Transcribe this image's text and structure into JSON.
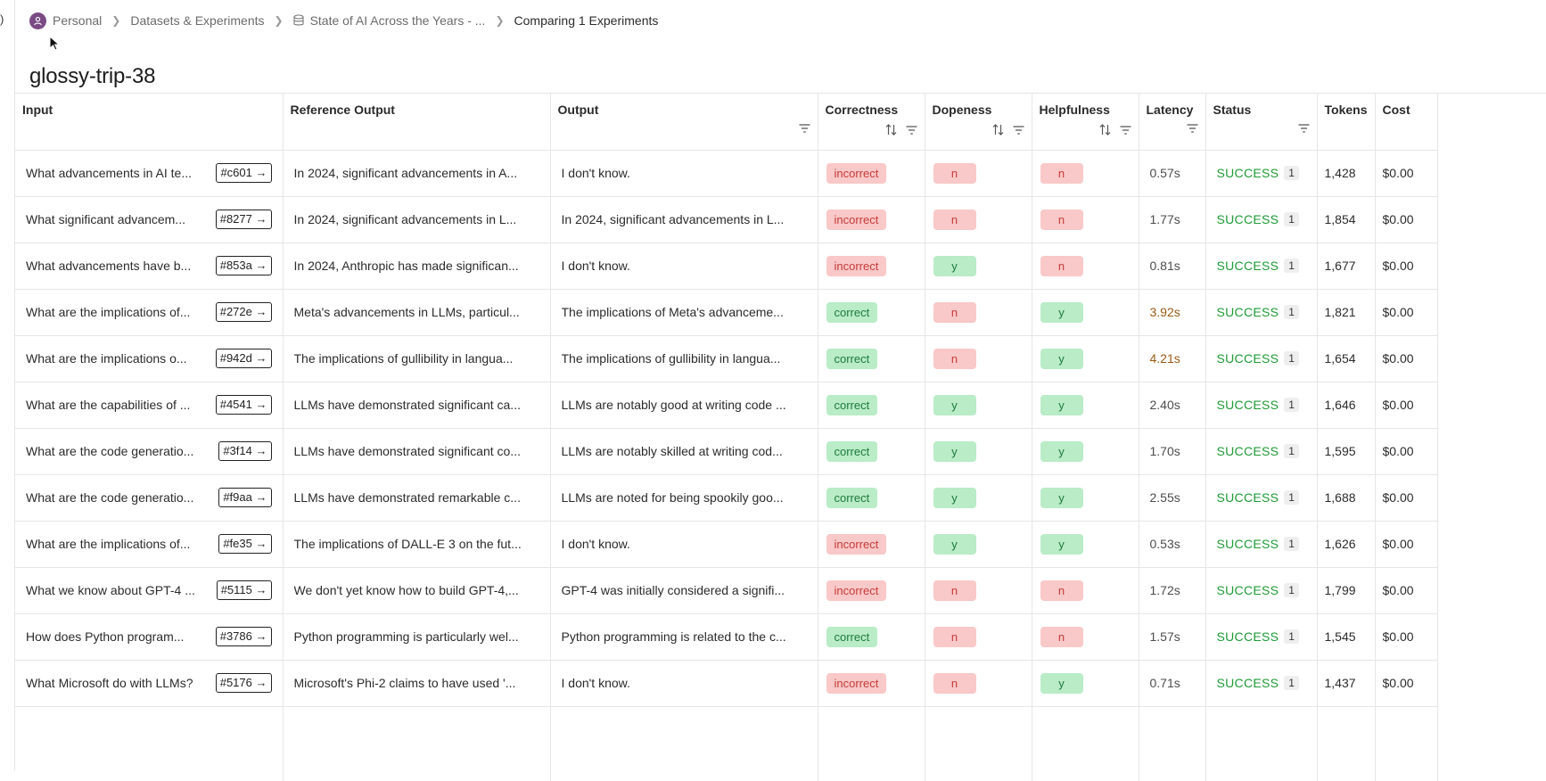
{
  "breadcrumb": {
    "personal": "Personal",
    "datasets": "Datasets & Experiments",
    "dataset": "State of AI Across the Years - ...",
    "current": "Comparing 1 Experiments"
  },
  "page_title": "glossy-trip-38",
  "columns": {
    "input": "Input",
    "reference": "Reference Output",
    "output": "Output",
    "correctness": "Correctness",
    "dopeness": "Dopeness",
    "helpfulness": "Helpfulness",
    "latency": "Latency",
    "status": "Status",
    "tokens": "Tokens",
    "cost": "Cost"
  },
  "rows": [
    {
      "input": "What advancements in AI te...",
      "id": "#c601",
      "reference": "In 2024, significant advancements in A...",
      "output": "I don't know.",
      "correctness": "incorrect",
      "dopeness": "n",
      "helpfulness": "n",
      "latency": "0.57s",
      "status": "SUCCESS",
      "count": "1",
      "tokens": "1,428",
      "cost": "$0.00"
    },
    {
      "input": "What significant advancem...",
      "id": "#8277",
      "reference": "In 2024, significant advancements in L...",
      "output": "In 2024, significant advancements in L...",
      "correctness": "incorrect",
      "dopeness": "n",
      "helpfulness": "n",
      "latency": "1.77s",
      "status": "SUCCESS",
      "count": "1",
      "tokens": "1,854",
      "cost": "$0.00"
    },
    {
      "input": "What advancements have b...",
      "id": "#853a",
      "reference": "In 2024, Anthropic has made significan...",
      "output": "I don't know.",
      "correctness": "incorrect",
      "dopeness": "y",
      "helpfulness": "n",
      "latency": "0.81s",
      "status": "SUCCESS",
      "count": "1",
      "tokens": "1,677",
      "cost": "$0.00"
    },
    {
      "input": "What are the implications of...",
      "id": "#272e",
      "reference": "Meta's advancements in LLMs, particul...",
      "output": "The implications of Meta's advanceme...",
      "correctness": "correct",
      "dopeness": "n",
      "helpfulness": "y",
      "latency": "3.92s",
      "status": "SUCCESS",
      "count": "1",
      "tokens": "1,821",
      "cost": "$0.00"
    },
    {
      "input": "What are the implications o...",
      "id": "#942d",
      "reference": "The implications of gullibility in langua...",
      "output": "The implications of gullibility in langua...",
      "correctness": "correct",
      "dopeness": "n",
      "helpfulness": "y",
      "latency": "4.21s",
      "status": "SUCCESS",
      "count": "1",
      "tokens": "1,654",
      "cost": "$0.00"
    },
    {
      "input": "What are the capabilities of ...",
      "id": "#4541",
      "reference": "LLMs have demonstrated significant ca...",
      "output": "LLMs are notably good at writing code ...",
      "correctness": "correct",
      "dopeness": "y",
      "helpfulness": "y",
      "latency": "2.40s",
      "status": "SUCCESS",
      "count": "1",
      "tokens": "1,646",
      "cost": "$0.00"
    },
    {
      "input": "What are the code generatio...",
      "id": "#3f14",
      "reference": "LLMs have demonstrated significant co...",
      "output": "LLMs are notably skilled at writing cod...",
      "correctness": "correct",
      "dopeness": "y",
      "helpfulness": "y",
      "latency": "1.70s",
      "status": "SUCCESS",
      "count": "1",
      "tokens": "1,595",
      "cost": "$0.00"
    },
    {
      "input": "What are the code generatio...",
      "id": "#f9aa",
      "reference": "LLMs have demonstrated remarkable c...",
      "output": "LLMs are noted for being spookily goo...",
      "correctness": "correct",
      "dopeness": "y",
      "helpfulness": "y",
      "latency": "2.55s",
      "status": "SUCCESS",
      "count": "1",
      "tokens": "1,688",
      "cost": "$0.00"
    },
    {
      "input": "What are the implications of...",
      "id": "#fe35",
      "reference": "The implications of DALL-E 3 on the fut...",
      "output": "I don't know.",
      "correctness": "incorrect",
      "dopeness": "y",
      "helpfulness": "y",
      "latency": "0.53s",
      "status": "SUCCESS",
      "count": "1",
      "tokens": "1,626",
      "cost": "$0.00"
    },
    {
      "input": "What we know about GPT-4 ...",
      "id": "#5115",
      "reference": "We don't yet know how to build GPT-4,...",
      "output": "GPT-4 was initially considered a signifi...",
      "correctness": "incorrect",
      "dopeness": "n",
      "helpfulness": "n",
      "latency": "1.72s",
      "status": "SUCCESS",
      "count": "1",
      "tokens": "1,799",
      "cost": "$0.00"
    },
    {
      "input": "How does Python program...",
      "id": "#3786",
      "reference": "Python programming is particularly wel...",
      "output": "Python programming is related to the c...",
      "correctness": "correct",
      "dopeness": "n",
      "helpfulness": "n",
      "latency": "1.57s",
      "status": "SUCCESS",
      "count": "1",
      "tokens": "1,545",
      "cost": "$0.00"
    },
    {
      "input": "What Microsoft do with LLMs?",
      "id": "#5176",
      "reference": "Microsoft's Phi-2 claims to have used '...",
      "output": "I don't know.",
      "correctness": "incorrect",
      "dopeness": "n",
      "helpfulness": "y",
      "latency": "0.71s",
      "status": "SUCCESS",
      "count": "1",
      "tokens": "1,437",
      "cost": "$0.00"
    }
  ],
  "colors": {
    "bad_bg": "#f9c8c8",
    "bad_fg": "#c83a3a",
    "good_bg": "#b9ecc7",
    "good_fg": "#1e7a3b",
    "success": "#1f9a36",
    "latency_warn": "#9a5a14"
  }
}
